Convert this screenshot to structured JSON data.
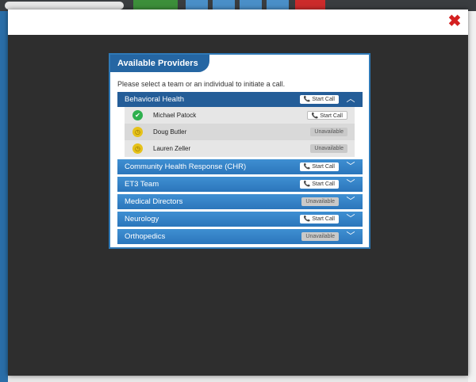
{
  "modal": {
    "close_label": "✖"
  },
  "panel": {
    "title": "Available Providers",
    "instruction": "Please select a team or an individual to initiate a call."
  },
  "groups": [
    {
      "name": "Behavioral Health",
      "action": "Start Call",
      "expanded": true
    },
    {
      "name": "Community Health Response (CHR)",
      "action": "Start Call"
    },
    {
      "name": "ET3 Team",
      "action": "Start Call"
    },
    {
      "name": "Medical Directors",
      "action": "Unavailable"
    },
    {
      "name": "Neurology",
      "action": "Start Call"
    },
    {
      "name": "Orthopedics",
      "action": "Unavailable"
    }
  ],
  "members": [
    {
      "name": "Michael Patock",
      "status": "available",
      "action": "Start Call"
    },
    {
      "name": "Doug Butler",
      "status": "away",
      "action": "Unavailable"
    },
    {
      "name": "Lauren Zeller",
      "status": "away",
      "action": "Unavailable"
    }
  ],
  "colors": {
    "brand_blue": "#2b76bb",
    "available_green": "#2fb04f",
    "away_yellow": "#e6c21a",
    "close_red": "#d42020"
  }
}
